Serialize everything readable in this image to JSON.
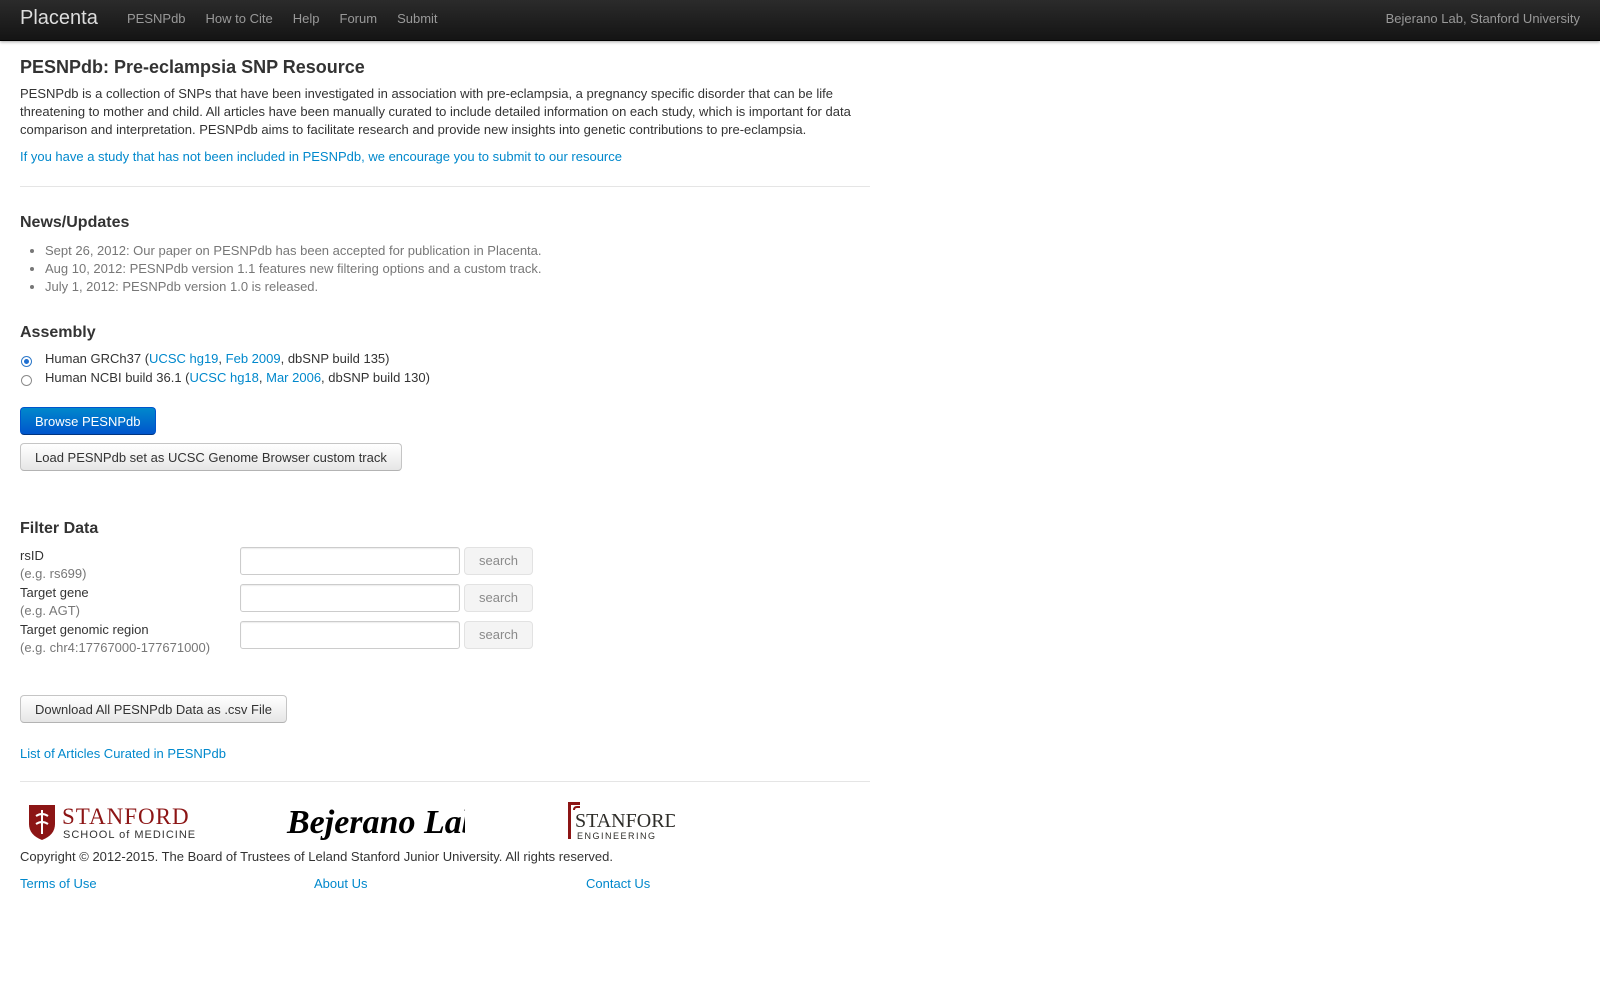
{
  "navbar": {
    "brand": "Placenta",
    "items": [
      "PESNPdb",
      "How to Cite",
      "Help",
      "Forum",
      "Submit"
    ],
    "right_text": "Bejerano Lab, Stanford University"
  },
  "main": {
    "title": "PESNPdb: Pre-eclampsia SNP Resource",
    "intro": "PESNPdb is a collection of SNPs that have been investigated in association with pre-eclampsia, a pregnancy specific disorder that can be life threatening to mother and child. All articles have been manually curated to include detailed information on each study, which is important for data comparison and interpretation. PESNPdb aims to facilitate research and provide new insights into genetic contributions to pre-eclampsia.",
    "submit_link": "If you have a study that has not been included in PESNPdb, we encourage you to submit to our resource"
  },
  "news": {
    "title": "News/Updates",
    "items": [
      "Sept 26, 2012: Our paper on PESNPdb has been accepted for publication in Placenta.",
      "Aug 10, 2012: PESNPdb version 1.1 features new filtering options and a custom track.",
      "July 1, 2012: PESNPdb version 1.0 is released."
    ]
  },
  "assembly": {
    "title": "Assembly",
    "options": [
      {
        "prefix": "Human GRCh37 (",
        "link1": "UCSC hg19",
        "sep": ", ",
        "link2": "Feb 2009",
        "suffix": ", dbSNP build 135)",
        "checked": true
      },
      {
        "prefix": "Human NCBI build 36.1 (",
        "link1": "UCSC hg18",
        "sep": ", ",
        "link2": "Mar 2006",
        "suffix": ", dbSNP build 130)",
        "checked": false
      }
    ],
    "browse_button": "Browse PESNPdb",
    "load_button": "Load PESNPdb set as UCSC Genome Browser custom track"
  },
  "filter": {
    "title": "Filter Data",
    "rows": [
      {
        "label": "rsID",
        "example": "(e.g. rs699)",
        "button": "search",
        "value": ""
      },
      {
        "label": "Target gene",
        "example": "(e.g. AGT)",
        "button": "search",
        "value": ""
      },
      {
        "label": "Target genomic region",
        "example": "(e.g. chr4:17767000-177671000)",
        "button": "search",
        "value": ""
      }
    ],
    "download_button": "Download All PESNPdb Data as .csv File",
    "articles_link": "List of Articles Curated in PESNPdb"
  },
  "footer": {
    "logos": {
      "stanford_medicine": "STANFORD",
      "stanford_medicine_sub": "SCHOOL of MEDICINE",
      "bejerano": "Bejerano Lab",
      "stanford_engineering": "STANFORD",
      "stanford_engineering_sub": "ENGINEERING"
    },
    "copyright": "Copyright © 2012-2015. The Board of Trustees of Leland Stanford Junior University. All rights reserved.",
    "links": [
      "Terms of Use",
      "About Us",
      "Contact Us"
    ]
  },
  "colors": {
    "link": "#0088cc",
    "navbar": "#1b1b1b",
    "primary_button": "#006dcc",
    "stanford_red": "#8c1515"
  }
}
